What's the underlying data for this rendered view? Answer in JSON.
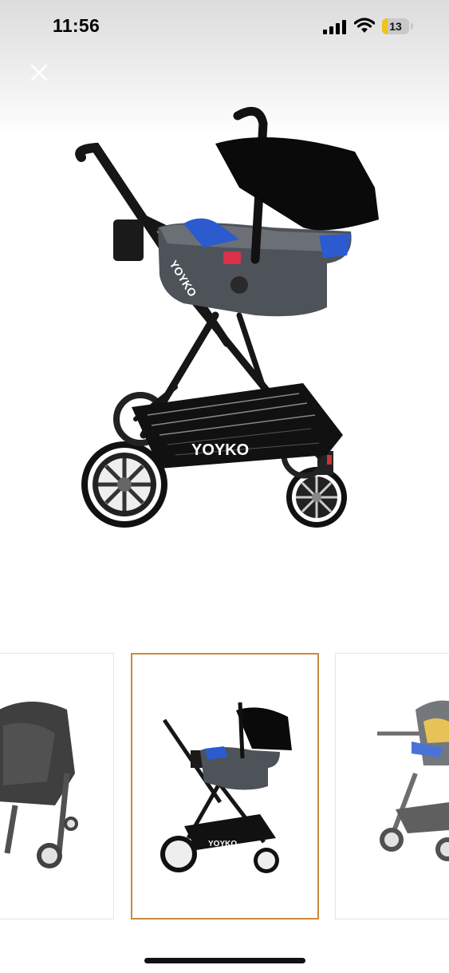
{
  "status_bar": {
    "time": "11:56",
    "battery_level": "13",
    "icons": [
      "signal-icon",
      "wifi-icon",
      "battery-icon"
    ]
  },
  "toolbar": {
    "close_icon": "close-icon"
  },
  "main_image": {
    "brand_logo_text": "YOYKO"
  },
  "gallery": {
    "selected_index": 1,
    "accent_color": "#c98a3c"
  }
}
